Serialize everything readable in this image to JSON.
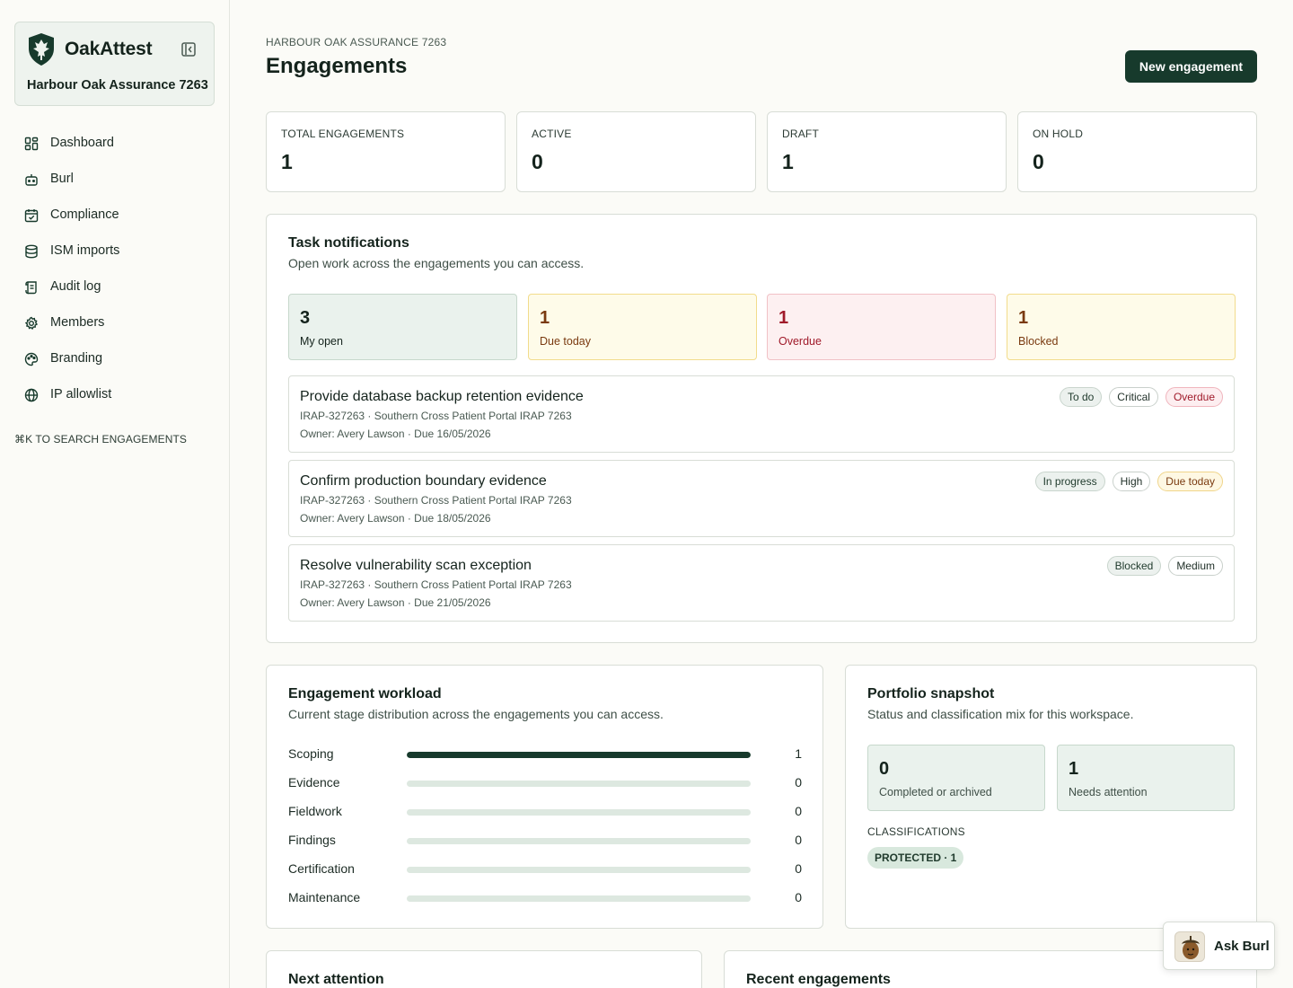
{
  "brand": {
    "name": "OakAttest",
    "org": "Harbour Oak Assurance 7263"
  },
  "nav": [
    {
      "label": "Dashboard",
      "icon": "dashboard-icon"
    },
    {
      "label": "Burl",
      "icon": "bot-icon"
    },
    {
      "label": "Compliance",
      "icon": "calendar-check-icon"
    },
    {
      "label": "ISM imports",
      "icon": "database-icon"
    },
    {
      "label": "Audit log",
      "icon": "scroll-icon"
    },
    {
      "label": "Members",
      "icon": "gear-icon"
    },
    {
      "label": "Branding",
      "icon": "palette-icon"
    },
    {
      "label": "IP allowlist",
      "icon": "globe-icon"
    }
  ],
  "search_hint": "⌘K TO SEARCH ENGAGEMENTS",
  "header": {
    "org_label": "HARBOUR OAK ASSURANCE 7263",
    "title": "Engagements",
    "new_button": "New engagement"
  },
  "stats": [
    {
      "label": "TOTAL ENGAGEMENTS",
      "value": "1"
    },
    {
      "label": "ACTIVE",
      "value": "0"
    },
    {
      "label": "DRAFT",
      "value": "1"
    },
    {
      "label": "ON HOLD",
      "value": "0"
    }
  ],
  "notifications": {
    "title": "Task notifications",
    "subtitle": "Open work across the engagements you can access.",
    "tiles": [
      {
        "value": "3",
        "label": "My open",
        "tone": "green"
      },
      {
        "value": "1",
        "label": "Due today",
        "tone": "yellow"
      },
      {
        "value": "1",
        "label": "Overdue",
        "tone": "red"
      },
      {
        "value": "1",
        "label": "Blocked",
        "tone": "yellow"
      }
    ],
    "tasks": [
      {
        "title": "Provide database backup retention evidence",
        "meta": "IRAP-327263 · Southern Cross Patient Portal IRAP 7263",
        "owner": "Owner: Avery Lawson · Due 16/05/2026",
        "badges": [
          {
            "text": "To do",
            "tone": "gray"
          },
          {
            "text": "Critical",
            "tone": "white"
          },
          {
            "text": "Overdue",
            "tone": "red"
          }
        ]
      },
      {
        "title": "Confirm production boundary evidence",
        "meta": "IRAP-327263 · Southern Cross Patient Portal IRAP 7263",
        "owner": "Owner: Avery Lawson · Due 18/05/2026",
        "badges": [
          {
            "text": "In progress",
            "tone": "gray"
          },
          {
            "text": "High",
            "tone": "white"
          },
          {
            "text": "Due today",
            "tone": "yellow"
          }
        ]
      },
      {
        "title": "Resolve vulnerability scan exception",
        "meta": "IRAP-327263 · Southern Cross Patient Portal IRAP 7263",
        "owner": "Owner: Avery Lawson · Due 21/05/2026",
        "badges": [
          {
            "text": "Blocked",
            "tone": "gray"
          },
          {
            "text": "Medium",
            "tone": "white"
          }
        ]
      }
    ]
  },
  "workload": {
    "title": "Engagement workload",
    "subtitle": "Current stage distribution across the engagements you can access.",
    "max": 1,
    "stages": [
      {
        "label": "Scoping",
        "count": 1
      },
      {
        "label": "Evidence",
        "count": 0
      },
      {
        "label": "Fieldwork",
        "count": 0
      },
      {
        "label": "Findings",
        "count": 0
      },
      {
        "label": "Certification",
        "count": 0
      },
      {
        "label": "Maintenance",
        "count": 0
      }
    ]
  },
  "snapshot": {
    "title": "Portfolio snapshot",
    "subtitle": "Status and classification mix for this workspace.",
    "tiles": [
      {
        "value": "0",
        "label": "Completed or archived"
      },
      {
        "value": "1",
        "label": "Needs attention"
      }
    ],
    "classifications_label": "CLASSIFICATIONS",
    "classification_badge": "PROTECTED · 1"
  },
  "next_attention": {
    "title": "Next attention"
  },
  "recent": {
    "title": "Recent engagements"
  },
  "ask": {
    "label": "Ask Burl"
  },
  "colors": {
    "accent": "#173a2c",
    "background": "#fbfbf7",
    "danger": "#a01a2a",
    "warning": "#7a3a10"
  }
}
